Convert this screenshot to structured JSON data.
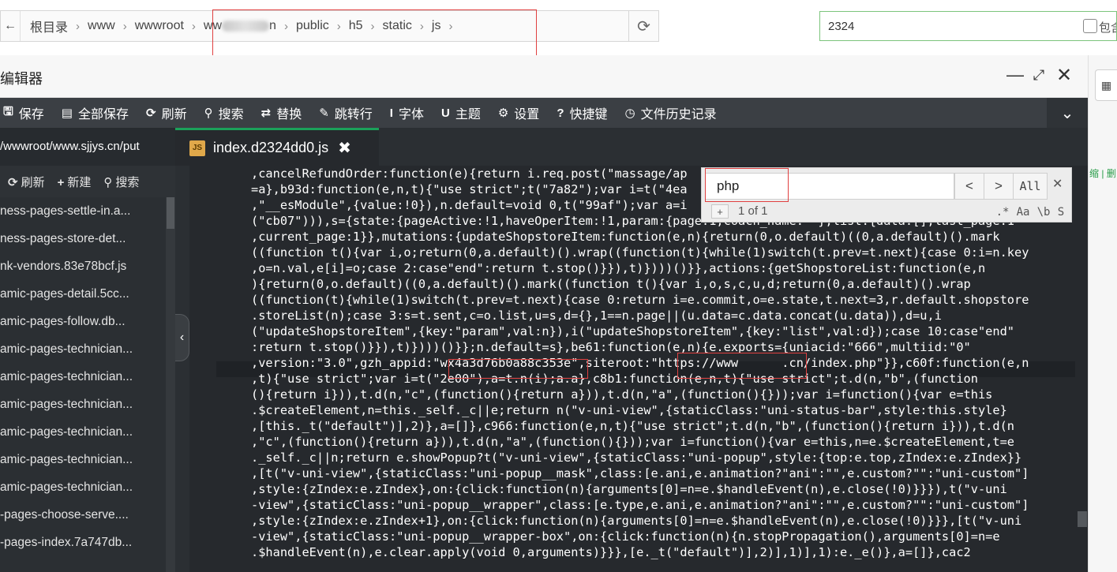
{
  "topbar": {
    "back_icon": "←",
    "crumbs": [
      "根目录",
      "www",
      "wwwroot",
      "ww",
      "n",
      "public",
      "h5",
      "static",
      "js"
    ],
    "search_value": "2324",
    "include_label": "包含"
  },
  "editor": {
    "title": "编辑器",
    "toolbar": [
      {
        "icon": "save-icon",
        "glyph": "🖫",
        "label": "保存"
      },
      {
        "icon": "save-all-icon",
        "glyph": "▤",
        "label": "全部保存"
      },
      {
        "icon": "refresh-icon",
        "glyph": "⟳",
        "label": "刷新"
      },
      {
        "icon": "search-icon",
        "glyph": "⚲",
        "label": "搜索"
      },
      {
        "icon": "replace-icon",
        "glyph": "⇄",
        "label": "替换"
      },
      {
        "icon": "goto-line-icon",
        "glyph": "✎",
        "label": "跳转行"
      },
      {
        "icon": "font-icon",
        "glyph": "I",
        "label": "字体"
      },
      {
        "icon": "theme-icon",
        "glyph": "U",
        "label": "主题"
      },
      {
        "icon": "settings-icon",
        "glyph": "⚙",
        "label": "设置"
      },
      {
        "icon": "help-icon",
        "glyph": "?",
        "label": "快捷键"
      },
      {
        "icon": "history-icon",
        "glyph": "◷",
        "label": "文件历史记录"
      }
    ],
    "sidebar": {
      "path": "/wwwroot/www.sjjys.cn/put",
      "actions": [
        {
          "icon": "refresh-icon",
          "glyph": "⟳",
          "label": "刷新"
        },
        {
          "icon": "plus-icon",
          "glyph": "+",
          "label": "新建"
        },
        {
          "icon": "search-icon",
          "glyph": "⚲",
          "label": "搜索"
        }
      ],
      "files": [
        "ness-pages-settle-in.a...",
        "ness-pages-store-det...",
        "nk-vendors.83e78bcf.js",
        "amic-pages-detail.5cc...",
        "amic-pages-follow.db...",
        "amic-pages-technician...",
        "amic-pages-technician...",
        "amic-pages-technician...",
        "amic-pages-technician...",
        "amic-pages-technician...",
        "amic-pages-technician...",
        "-pages-choose-serve....",
        "-pages-index.7a747db..."
      ]
    },
    "tab": {
      "file_type": "JS",
      "name": "index.d2324dd0.js",
      "close": "✖"
    },
    "code_lines": [
      ",cancelRefundOrder:function(e){return i.req.post(\"massage/ap",
      "=a},b93d:function(e,n,t){\"use strict\";t(\"7a82\");var i=t(\"4ea",
      ",\"__esModule\",{value:!0}),n.default=void 0,t(\"99af\");var a=i",
      "(\"cb07\"))),s={state:{pageActive:!1,haveOperItem:!1,param:{page:1,coach_name:\"\"},list:{data:[],last_page:1",
      ",current_page:1}},mutations:{updateShopstoreItem:function(e,n){return(0,o.default)((0,a.default)().mark",
      "((function t(){var i,o;return(0,a.default)().wrap((function(t){while(1)switch(t.prev=t.next){case 0:i=n.key",
      ",o=n.val,e[i]=o;case 2:case\"end\":return t.stop()}}),t)})))()}},actions:{getShopstoreList:function(e,n",
      "){return(0,o.default)((0,a.default)().mark((function t(){var i,o,s,c,u,d;return(0,a.default)().wrap",
      "((function(t){while(1)switch(t.prev=t.next){case 0:return i=e.commit,o=e.state,t.next=3,r.default.shopstore",
      ".storeList(n);case 3:s=t.sent,c=o.list,u=s,d={},1==n.page||(u.data=c.data.concat(u.data)),d=u,i",
      "(\"updateShopstoreItem\",{key:\"param\",val:n}),i(\"updateShopstoreItem\",{key:\"list\",val:d});case 10:case\"end\"",
      ":return t.stop()}}),t)})))()}};n.default=s},be61:function(e,n){e.exports={uniacid:\"666\",multiid:\"0\"",
      ",version:\"3.0\",gzh_appid:\"wx4a3d76b0a88c353e\",siteroot:\"https://www      .cn/index.php\"}},c60f:function(e,n",
      ",t){\"use strict\";var i=t(\"2e00\"),a=t.n(i);a.a},c8b1:function(e,n,t){\"use strict\";t.d(n,\"b\",(function",
      "(){return i})),t.d(n,\"c\",(function(){return a})),t.d(n,\"a\",(function(){}));var i=function(){var e=this",
      ".$createElement,n=this._self._c||e;return n(\"v-uni-view\",{staticClass:\"uni-status-bar\",style:this.style}",
      ",[this._t(\"default\")],2)},a=[]},c966:function(e,n,t){\"use strict\";t.d(n,\"b\",(function(){return i})),t.d(n",
      ",\"c\",(function(){return a})),t.d(n,\"a\",(function(){}));var i=function(){var e=this,n=e.$createElement,t=e",
      "._self._c||n;return e.showPopup?t(\"v-uni-view\",{staticClass:\"uni-popup\",style:{top:e.top,zIndex:e.zIndex}}",
      ",[t(\"v-uni-view\",{staticClass:\"uni-popup__mask\",class:[e.ani,e.animation?\"ani\":\"\",e.custom?\"\":\"uni-custom\"]",
      ",style:{zIndex:e.zIndex},on:{click:function(n){arguments[0]=n=e.$handleEvent(n),e.close(!0)}}}),t(\"v-uni",
      "-view\",{staticClass:\"uni-popup__wrapper\",class:[e.type,e.ani,e.animation?\"ani\":\"\",e.custom?\"\":\"uni-custom\"]",
      ",style:{zIndex:e.zIndex+1},on:{click:function(n){arguments[0]=n=e.$handleEvent(n),e.close(!0)}}},[t(\"v-uni",
      "-view\",{staticClass:\"uni-popup__wrapper-box\",on:{click:function(n){n.stopPropagation(),arguments[0]=n=e",
      ".$handleEvent(n),e.clear.apply(void 0,arguments)}}},[e._t(\"default\")],2)],1)],1):e._e()},a=[]},cac2"
    ],
    "find": {
      "query": "php",
      "prev": "<",
      "next": ">",
      "all": "All",
      "close": "✕",
      "plus": "+",
      "count": "1 of 1",
      "opt_regex": ".*",
      "opt_case": "Aa",
      "opt_word": "\\b",
      "opt_sel": "S"
    }
  },
  "right_edge": {
    "fragment": "缩 | 删"
  },
  "colors": {
    "accent_green": "#1ba15a",
    "highlight_red": "#e04040",
    "editor_bg": "#26292d",
    "toolbar_bg": "#3b3f44"
  }
}
